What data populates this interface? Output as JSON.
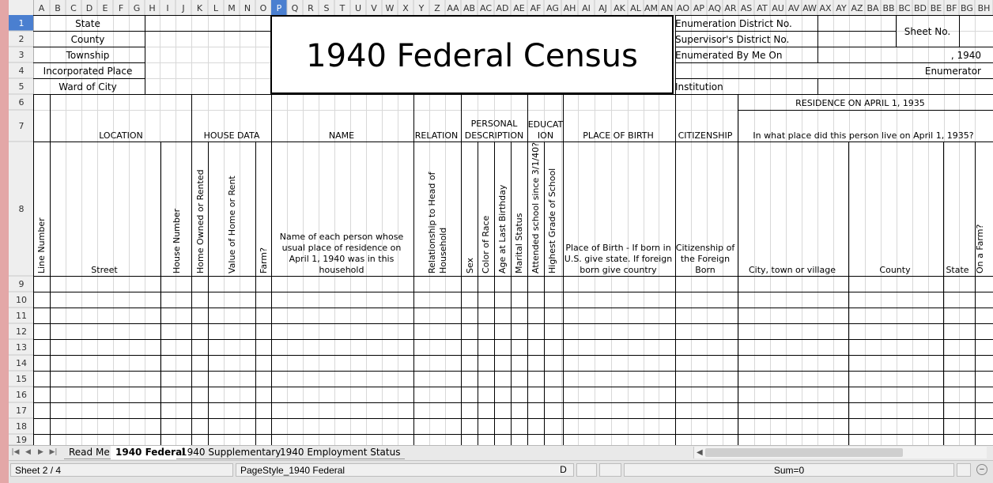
{
  "columns": [
    "A",
    "B",
    "C",
    "D",
    "E",
    "F",
    "G",
    "H",
    "I",
    "J",
    "K",
    "L",
    "M",
    "N",
    "O",
    "P",
    "Q",
    "R",
    "S",
    "T",
    "U",
    "V",
    "W",
    "X",
    "Y",
    "Z",
    "AA",
    "AB",
    "AC",
    "AD",
    "AE",
    "AF",
    "AG",
    "AH",
    "AI",
    "AJ",
    "AK",
    "AL",
    "AM",
    "AN",
    "AO",
    "AP",
    "AQ",
    "AR",
    "AS",
    "AT",
    "AU",
    "AV",
    "AW",
    "AX",
    "AY",
    "AZ",
    "BA",
    "BB",
    "BC",
    "BD",
    "BE",
    "BF",
    "BG",
    "BH"
  ],
  "selected_column": "P",
  "rows": [
    "1",
    "2",
    "3",
    "4",
    "5",
    "6",
    "7",
    "8",
    "9",
    "10",
    "11",
    "12",
    "13",
    "14",
    "15",
    "16",
    "17",
    "18",
    "19"
  ],
  "selected_row": "1",
  "form": {
    "title": "1940 Federal Census",
    "left_labels": [
      "State",
      "County",
      "Township",
      "Incorporated Place",
      "Ward of City"
    ],
    "enum_district": "Enumeration District No.",
    "supervisor_district": "Supervisor's District No.",
    "enumerated_by": "Enumerated By Me On",
    "year": ", 1940",
    "enumerator": "Enumerator",
    "institution": "Institution",
    "sheet_no": "Sheet No."
  },
  "headers": {
    "location": "LOCATION",
    "house_data": "HOUSE DATA",
    "name": "NAME",
    "relation": "RELATION",
    "personal_1": "PERSONAL",
    "personal_2": "DESCRIPTION",
    "education_1": "EDUCAT",
    "education_2": "ION",
    "place_of_birth": "PLACE OF BIRTH",
    "citizenship": "CITIZENSHIP",
    "residence": "RESIDENCE ON APRIL 1, 1935",
    "residence_question": "In what place did this person live on April 1, 1935?"
  },
  "subheaders": {
    "line_number": "Line Number",
    "street": "Street",
    "house_number": "House Number",
    "home_owned": "Home Owned or Rented",
    "value_home": "Value of Home or Rent",
    "farm": "Farm?",
    "name_desc": [
      "Name of each person whose",
      "usual place of residence on",
      "April 1, 1940 was in this",
      "household"
    ],
    "relationship": [
      "Relationship to Head of",
      "Household"
    ],
    "sex": "Sex",
    "color_race": "Color of Race",
    "age": "Age at Last Birthday",
    "marital": "Marital Status",
    "attended_school": "Attended school since 3/1/40?",
    "highest_grade": "Highest Grade of School",
    "pob_desc": [
      "Place of Birth -  If born in",
      "U.S. give state.  If foreign",
      "born give country"
    ],
    "cit_desc": [
      "Citizenship of",
      "the Foreign",
      "Born"
    ],
    "city": "City, town or village",
    "county": "County",
    "state": "State",
    "on_farm": "On a Farm?"
  },
  "tabs": [
    {
      "label": "Read Me",
      "active": false
    },
    {
      "label": "1940 Federal",
      "active": true
    },
    {
      "label": "1940 Supplementary",
      "active": false
    },
    {
      "label": "1940 Employment Status",
      "active": false
    }
  ],
  "status": {
    "sheet": "Sheet 2 / 4",
    "page_style": "PageStyle_1940 Federal",
    "mode": "D",
    "sum": "Sum=0"
  },
  "icons": {
    "nav": [
      "first-sheet-icon",
      "prev-sheet-icon",
      "next-sheet-icon",
      "last-sheet-icon"
    ],
    "zoom_out": "zoom-out-icon"
  }
}
